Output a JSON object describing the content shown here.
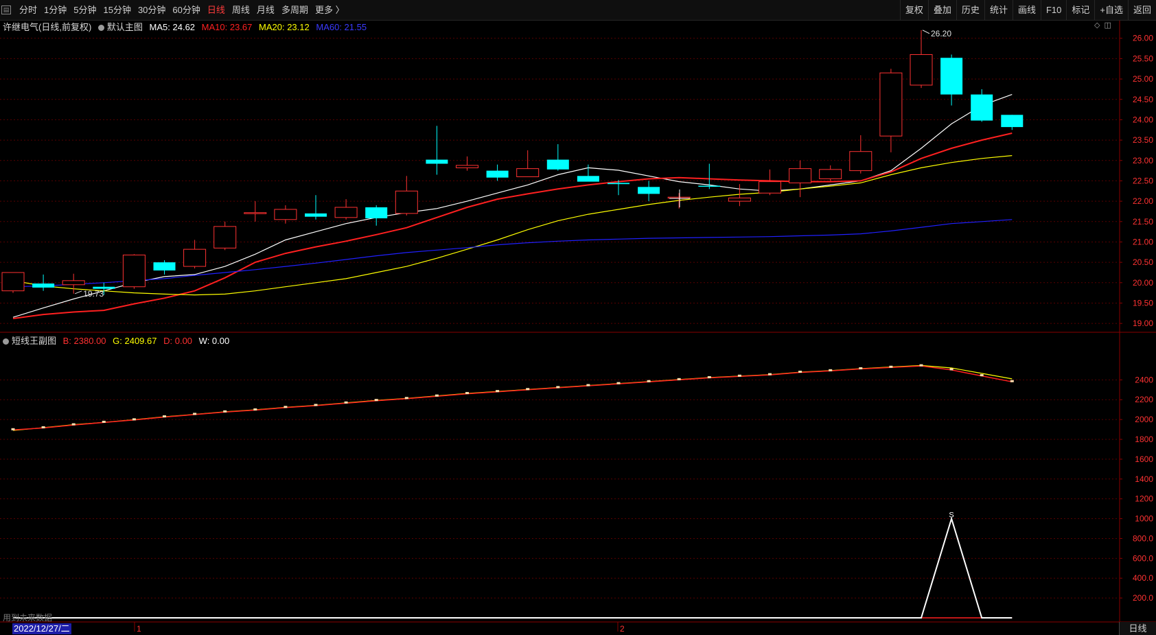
{
  "toolbar": {
    "periods": [
      "分时",
      "1分钟",
      "5分钟",
      "15分钟",
      "30分钟",
      "60分钟",
      "日线",
      "周线",
      "月线",
      "多周期",
      "更多 〉"
    ],
    "active_period": "日线",
    "tools": [
      "复权",
      "叠加",
      "历史",
      "统计",
      "画线",
      "F10",
      "标记",
      "+自选",
      "返回"
    ]
  },
  "main_info": {
    "title": "许继电气(日线,前复权)",
    "template": "默认主图",
    "ma5": "MA5: 24.62",
    "ma10": "MA10: 23.67",
    "ma20": "MA20: 23.12",
    "ma60": "MA60: 21.55"
  },
  "sub_info": {
    "title": "短线王副图",
    "b": "B: 2380.00",
    "g": "G: 2409.67",
    "d": "D: 0.00",
    "w": "W: 0.00"
  },
  "annotations": {
    "high": "26.20",
    "low": "19.73",
    "signal": "S",
    "tick1": "1",
    "tick2": "2"
  },
  "footer": {
    "date": "2022/12/27/二",
    "period": "日线",
    "no_data": "用到未来数据"
  },
  "colors": {
    "up": "#ff3232",
    "down": "#00ffff",
    "ma5": "#ffffff",
    "ma10": "#ff2020",
    "ma20": "#ffff00",
    "ma60": "#2020ff",
    "grid": "#5a0000"
  },
  "chart_data": [
    {
      "type": "candlestick",
      "title": "许继电气(日线,前复权)",
      "ylim": [
        18.8,
        26.4
      ],
      "y_ticks": [
        19.0,
        19.5,
        20.0,
        20.5,
        21.0,
        21.5,
        22.0,
        22.5,
        23.0,
        23.5,
        24.0,
        24.5,
        25.0,
        25.5,
        26.0
      ],
      "candles": [
        {
          "o": 19.8,
          "h": 20.25,
          "l": 19.75,
          "c": 20.25
        },
        {
          "o": 19.98,
          "h": 20.2,
          "l": 19.8,
          "c": 19.88
        },
        {
          "o": 19.95,
          "h": 20.22,
          "l": 19.73,
          "c": 20.05
        },
        {
          "o": 19.9,
          "h": 20.0,
          "l": 19.7,
          "c": 19.85
        },
        {
          "o": 19.9,
          "h": 20.7,
          "l": 19.85,
          "c": 20.68
        },
        {
          "o": 20.5,
          "h": 20.55,
          "l": 20.2,
          "c": 20.3
        },
        {
          "o": 20.4,
          "h": 21.05,
          "l": 20.35,
          "c": 20.82
        },
        {
          "o": 20.85,
          "h": 21.5,
          "l": 20.8,
          "c": 21.38
        },
        {
          "o": 21.72,
          "h": 22.0,
          "l": 21.5,
          "c": 21.72
        },
        {
          "o": 21.55,
          "h": 21.9,
          "l": 21.45,
          "c": 21.8
        },
        {
          "o": 21.7,
          "h": 22.15,
          "l": 21.55,
          "c": 21.62
        },
        {
          "o": 21.6,
          "h": 22.05,
          "l": 21.55,
          "c": 21.85
        },
        {
          "o": 21.85,
          "h": 21.9,
          "l": 21.4,
          "c": 21.58
        },
        {
          "o": 21.7,
          "h": 22.62,
          "l": 21.65,
          "c": 22.25
        },
        {
          "o": 23.02,
          "h": 23.85,
          "l": 22.65,
          "c": 22.92
        },
        {
          "o": 22.82,
          "h": 23.1,
          "l": 22.75,
          "c": 22.88
        },
        {
          "o": 22.75,
          "h": 22.9,
          "l": 22.5,
          "c": 22.58
        },
        {
          "o": 22.6,
          "h": 23.25,
          "l": 22.6,
          "c": 22.8
        },
        {
          "o": 23.02,
          "h": 23.4,
          "l": 22.75,
          "c": 22.78
        },
        {
          "o": 22.62,
          "h": 22.9,
          "l": 22.5,
          "c": 22.48
        },
        {
          "o": 22.45,
          "h": 22.52,
          "l": 22.15,
          "c": 22.42
        },
        {
          "o": 22.35,
          "h": 22.5,
          "l": 22.0,
          "c": 22.18
        },
        {
          "o": 22.1,
          "h": 22.2,
          "l": 21.82,
          "c": 22.1
        },
        {
          "o": 22.38,
          "h": 22.92,
          "l": 22.3,
          "c": 22.36
        },
        {
          "o": 22.0,
          "h": 22.42,
          "l": 21.88,
          "c": 22.08
        },
        {
          "o": 22.2,
          "h": 22.78,
          "l": 22.15,
          "c": 22.48
        },
        {
          "o": 22.45,
          "h": 23.0,
          "l": 22.1,
          "c": 22.8
        },
        {
          "o": 22.55,
          "h": 22.88,
          "l": 22.5,
          "c": 22.78
        },
        {
          "o": 22.75,
          "h": 23.62,
          "l": 22.68,
          "c": 23.22
        },
        {
          "o": 23.6,
          "h": 25.25,
          "l": 23.2,
          "c": 25.15
        },
        {
          "o": 24.85,
          "h": 26.2,
          "l": 24.78,
          "c": 25.6
        },
        {
          "o": 25.52,
          "h": 25.6,
          "l": 24.35,
          "c": 24.62
        },
        {
          "o": 24.62,
          "h": 24.75,
          "l": 23.95,
          "c": 23.98
        },
        {
          "o": 24.12,
          "h": 24.12,
          "l": 23.75,
          "c": 23.82
        }
      ],
      "series": [
        {
          "name": "MA5",
          "values": [
            19.15,
            19.38,
            19.6,
            19.8,
            20.0,
            20.15,
            20.2,
            20.4,
            20.7,
            21.05,
            21.25,
            21.45,
            21.6,
            21.72,
            21.82,
            22.0,
            22.2,
            22.4,
            22.65,
            22.82,
            22.76,
            22.62,
            22.48,
            22.4,
            22.3,
            22.25,
            22.3,
            22.4,
            22.5,
            22.75,
            23.3,
            23.9,
            24.35,
            24.62
          ]
        },
        {
          "name": "MA10",
          "values": [
            19.12,
            19.22,
            19.28,
            19.32,
            19.48,
            19.62,
            19.8,
            20.12,
            20.5,
            20.72,
            20.88,
            21.02,
            21.18,
            21.35,
            21.6,
            21.85,
            22.05,
            22.18,
            22.3,
            22.4,
            22.48,
            22.55,
            22.58,
            22.55,
            22.52,
            22.5,
            22.48,
            22.48,
            22.5,
            22.72,
            23.05,
            23.3,
            23.5,
            23.67
          ]
        },
        {
          "name": "MA20",
          "values": [
            20.05,
            19.92,
            19.85,
            19.8,
            19.75,
            19.72,
            19.7,
            19.72,
            19.8,
            19.9,
            20.0,
            20.1,
            20.25,
            20.4,
            20.6,
            20.82,
            21.05,
            21.3,
            21.52,
            21.68,
            21.8,
            21.92,
            22.02,
            22.1,
            22.17,
            22.22,
            22.3,
            22.37,
            22.45,
            22.65,
            22.82,
            22.95,
            23.05,
            23.12
          ]
        },
        {
          "name": "MA60",
          "values": [
            19.9,
            19.92,
            19.96,
            20.0,
            20.05,
            20.1,
            20.18,
            20.25,
            20.32,
            20.4,
            20.48,
            20.57,
            20.66,
            20.74,
            20.8,
            20.86,
            20.93,
            20.98,
            21.02,
            21.05,
            21.07,
            21.09,
            21.1,
            21.11,
            21.12,
            21.13,
            21.15,
            21.17,
            21.2,
            21.27,
            21.36,
            21.45,
            21.5,
            21.55
          ]
        }
      ]
    },
    {
      "type": "line",
      "title": "短线王副图",
      "ylim": [
        0,
        2700
      ],
      "y_ticks": [
        200,
        400,
        600,
        800,
        1000,
        1200,
        1400,
        1600,
        1800,
        2000,
        2200,
        2400
      ],
      "y_tick_labels": [
        "200.0",
        "400.0",
        "600.0",
        "800.0",
        "1000",
        "1200",
        "1400",
        "1600",
        "1800",
        "2000",
        "2200",
        "2400"
      ],
      "series": [
        {
          "name": "B",
          "values": [
            1895,
            1915,
            1945,
            1970,
            1995,
            2025,
            2050,
            2075,
            2095,
            2120,
            2140,
            2165,
            2190,
            2210,
            2235,
            2260,
            2280,
            2300,
            2320,
            2340,
            2360,
            2380,
            2400,
            2420,
            2435,
            2450,
            2475,
            2490,
            2510,
            2525,
            2540,
            2500,
            2440,
            2380
          ]
        },
        {
          "name": "G",
          "values": [
            1890,
            1918,
            1948,
            1972,
            1998,
            2028,
            2052,
            2078,
            2098,
            2123,
            2143,
            2168,
            2193,
            2213,
            2238,
            2263,
            2283,
            2303,
            2323,
            2343,
            2363,
            2383,
            2403,
            2423,
            2438,
            2453,
            2478,
            2493,
            2513,
            2530,
            2545,
            2520,
            2465,
            2409.67
          ]
        },
        {
          "name": "D",
          "values": [
            0,
            0,
            0,
            0,
            0,
            0,
            0,
            0,
            0,
            0,
            0,
            0,
            0,
            0,
            0,
            0,
            0,
            0,
            0,
            0,
            0,
            0,
            0,
            0,
            0,
            0,
            0,
            0,
            0,
            0,
            0,
            0,
            0,
            0
          ]
        },
        {
          "name": "W",
          "values": [
            0,
            0,
            0,
            0,
            0,
            0,
            0,
            0,
            0,
            0,
            0,
            0,
            0,
            0,
            0,
            0,
            0,
            0,
            0,
            0,
            0,
            0,
            0,
            0,
            0,
            0,
            0,
            0,
            0,
            0,
            0,
            1000,
            0,
            0
          ]
        }
      ]
    }
  ]
}
